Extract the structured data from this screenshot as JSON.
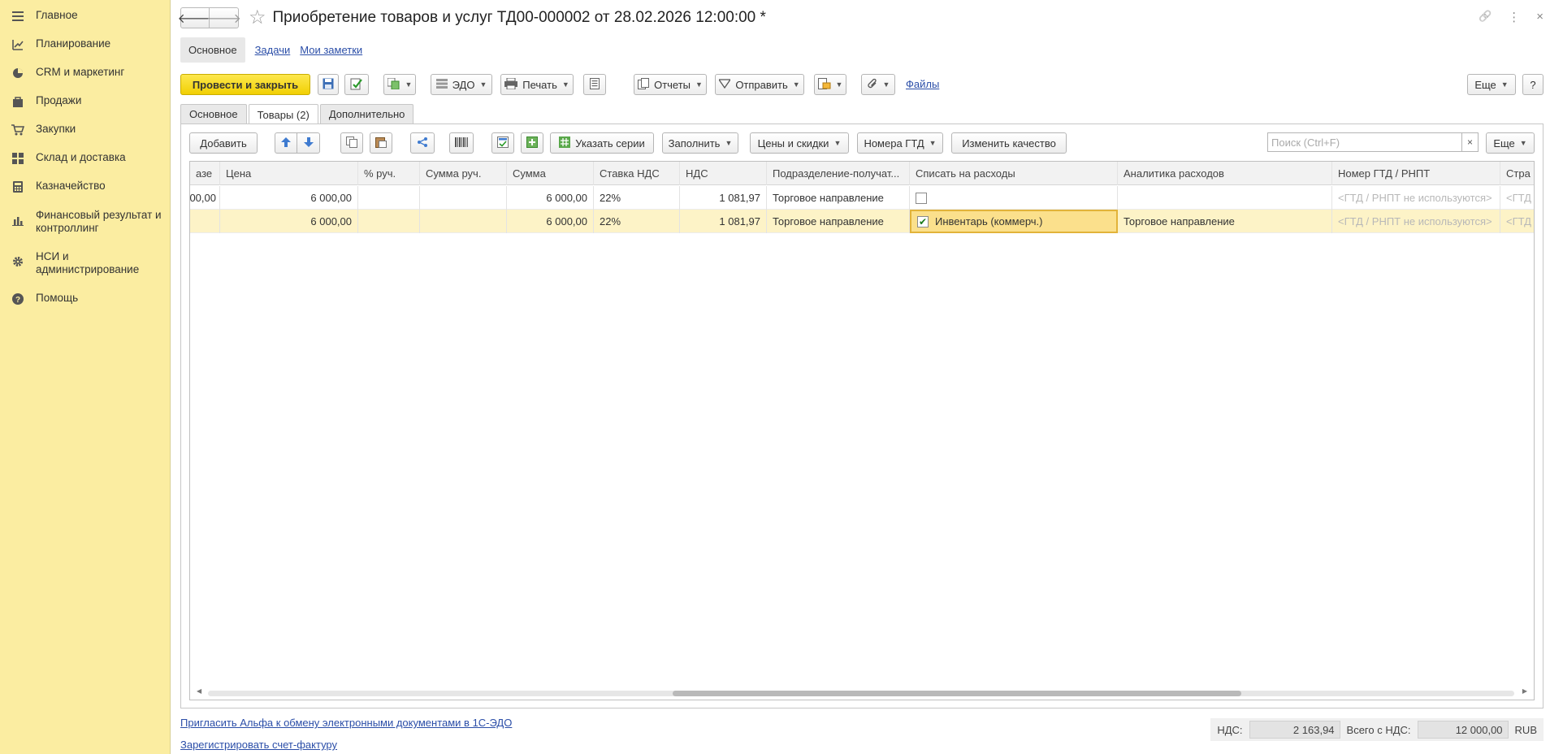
{
  "sidebar": {
    "items": [
      {
        "label": "Главное",
        "icon": "menu-icon"
      },
      {
        "label": "Планирование",
        "icon": "planning-icon"
      },
      {
        "label": "CRM и маркетинг",
        "icon": "pie-chart-icon"
      },
      {
        "label": "Продажи",
        "icon": "bag-icon"
      },
      {
        "label": "Закупки",
        "icon": "cart-icon"
      },
      {
        "label": "Склад и доставка",
        "icon": "grid-icon"
      },
      {
        "label": "Казначейство",
        "icon": "calculator-icon"
      },
      {
        "label": "Финансовый результат и контроллинг",
        "icon": "bar-chart-icon"
      },
      {
        "label": "НСИ и администрирование",
        "icon": "gear-icon"
      },
      {
        "label": "Помощь",
        "icon": "help-icon"
      }
    ]
  },
  "header": {
    "title": "Приобретение товаров и услуг ТД00-000002 от 28.02.2026 12:00:00 *",
    "back": "🡐",
    "forward": "🡒",
    "star": "☆",
    "link_icon": "🔗",
    "more_icon": "⋮",
    "close_icon": "×"
  },
  "subnav": {
    "active": "Основное",
    "links": [
      "Задачи",
      "Мои заметки"
    ]
  },
  "toolbar": {
    "post_close": "Провести и закрыть",
    "save_icon": "💾",
    "edo": "ЭДО",
    "print": "Печать",
    "reports": "Отчеты",
    "send": "Отправить",
    "files": "Файлы",
    "more": "Еще",
    "help": "?",
    "dropdown": "▼"
  },
  "doc_tabs": [
    "Основное",
    "Товары (2)",
    "Дополнительно"
  ],
  "table_toolbar": {
    "add": "Добавить",
    "specify_series": "Указать серии",
    "fill": "Заполнить",
    "prices": "Цены и скидки",
    "gtd": "Номера ГТД",
    "quality": "Изменить качество",
    "search_placeholder": "Поиск (Ctrl+F)",
    "clear": "×",
    "more": "Еще"
  },
  "table": {
    "columns": [
      "азе",
      "Цена",
      "% руч.",
      "Сумма руч.",
      "Сумма",
      "Ставка НДС",
      "НДС",
      "Подразделение-получат...",
      "Списать на расходы",
      "Аналитика расходов",
      "Номер ГТД / РНПТ",
      "Стра"
    ],
    "rows": [
      {
        "c0": "00,00",
        "price": "6 000,00",
        "pct": "",
        "sum_manual": "",
        "sum": "6 000,00",
        "vat_rate": "22%",
        "vat": "1 081,97",
        "dept": "Торговое направление",
        "writeoff_checked": false,
        "writeoff_text": "",
        "analytics": "",
        "gtd": "<ГТД / РНПТ не используются>",
        "country": "<ГТД"
      },
      {
        "c0": "",
        "price": "6 000,00",
        "pct": "",
        "sum_manual": "",
        "sum": "6 000,00",
        "vat_rate": "22%",
        "vat": "1 081,97",
        "dept": "Торговое направление",
        "writeoff_checked": true,
        "writeoff_text": "Инвентарь (коммерч.)",
        "analytics": "Торговое направление",
        "gtd": "<ГТД / РНПТ не используются>",
        "country": "<ГТД"
      }
    ],
    "checkmark": "✔"
  },
  "footer": {
    "invite_link": "Пригласить Альфа к обмену электронными документами в 1С-ЭДО",
    "register_link": "Зарегистрировать счет-фактуру",
    "vat_label": "НДС:",
    "vat_value": "2 163,94",
    "total_label": "Всего с НДС:",
    "total_value": "12 000,00",
    "currency": "RUB"
  },
  "colors": {
    "sidebar_bg": "#fbeda1",
    "primary_button": "#f5d600",
    "selected_row": "#fdf3c7",
    "link": "#2b4ea8"
  }
}
